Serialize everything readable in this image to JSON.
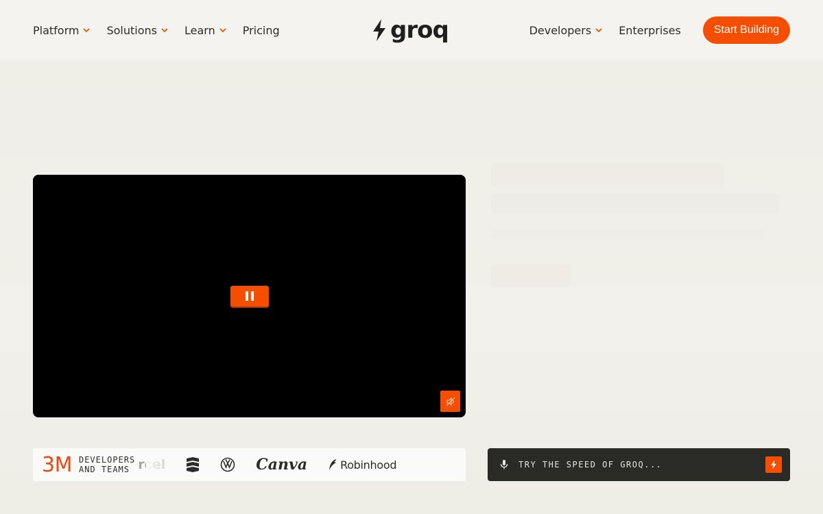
{
  "nav": {
    "left_items": [
      {
        "label": "Platform",
        "has_dropdown": true
      },
      {
        "label": "Solutions",
        "has_dropdown": true
      },
      {
        "label": "Learn",
        "has_dropdown": true
      },
      {
        "label": "Pricing",
        "has_dropdown": false
      }
    ],
    "logo_text": "groq",
    "right_items": [
      {
        "label": "Developers",
        "has_dropdown": true
      },
      {
        "label": "Enterprises",
        "has_dropdown": false
      }
    ],
    "cta_label": "Start Building"
  },
  "video": {
    "state": "playing",
    "pause_icon": "pause-icon",
    "mute_icon": "sound-muted-icon"
  },
  "stats": {
    "number": "3M",
    "label_line1": "DEVELOPERS",
    "label_line2": "AND TEAMS"
  },
  "brands": {
    "vercel": "rcel",
    "chevron_icon": "chevron-brand-logo",
    "vw_icon": "volkswagen-logo",
    "canva": "Canva",
    "robinhood": "Robinhood"
  },
  "prompt": {
    "text": "TRY THE SPEED OF GROQ...",
    "mic_icon": "microphone-icon",
    "submit_icon": "lightning-icon"
  },
  "colors": {
    "accent": "#f54e00",
    "background": "#f2f1ec",
    "dark": "#2a2a26"
  }
}
